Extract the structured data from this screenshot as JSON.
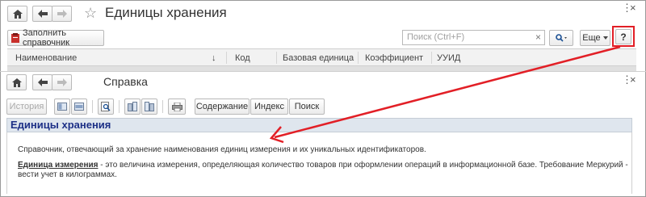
{
  "main_window": {
    "title": "Единицы хранения",
    "fill_button_label": "Заполнить справочник",
    "search_placeholder": "Поиск (Ctrl+F)",
    "search_clear": "×",
    "more_button": "Еще",
    "help_button": "?",
    "more_icon": "⋮",
    "close_icon": "×",
    "columns": [
      "Наименование",
      "Код",
      "Базовая единица",
      "Коэффициент",
      "УУИД"
    ],
    "sort_indicator": "↓"
  },
  "help_window": {
    "title": "Справка",
    "history_button": "История",
    "tabs": [
      "Содержание",
      "Индекс",
      "Поиск"
    ],
    "more_icon": "⋮",
    "close_icon": "×",
    "heading": "Единицы хранения",
    "paragraph1": "Справочник, отвечающий за хранение наименования единиц измерения и их уникальных идентификаторов.",
    "term": "Единица измерения",
    "paragraph2_rest": " - это величина измерения, определяющая количество товаров при оформлении операций в информационной базе. Требование Меркурий - вести учет в килограммах."
  },
  "colors": {
    "annotation_red": "#e21f26",
    "heading_blue": "#1c2f86",
    "banner_bg": "#dfe6ee"
  }
}
